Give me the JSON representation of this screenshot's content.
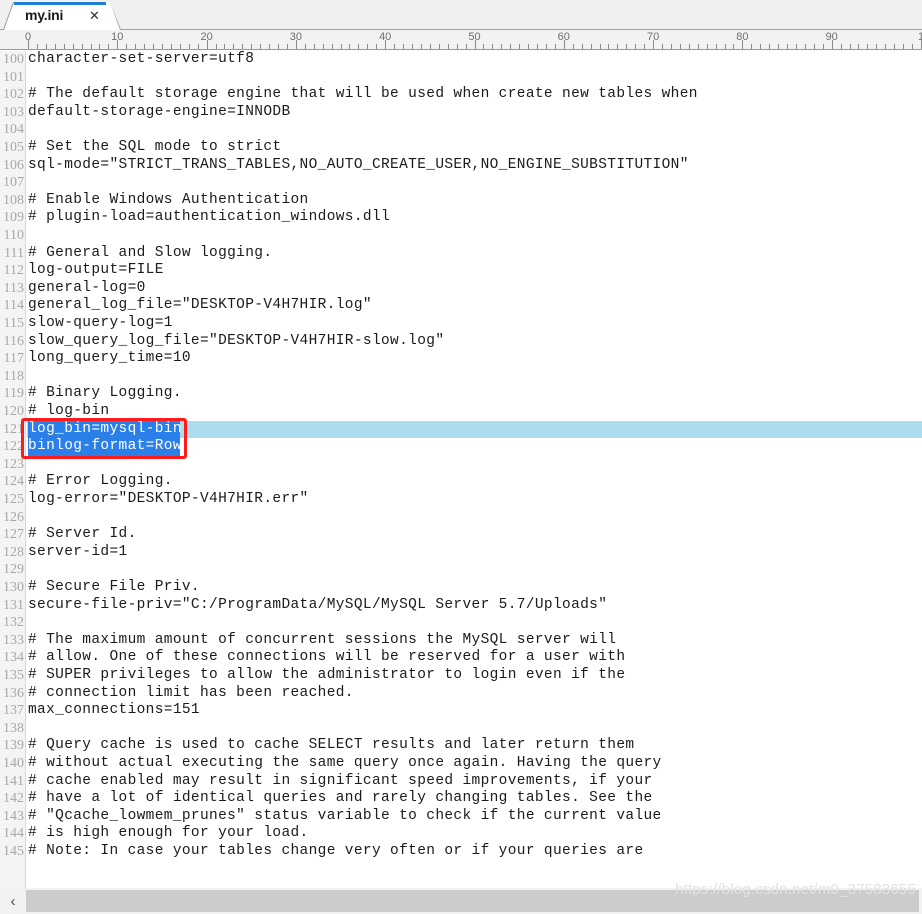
{
  "window": {
    "tab": {
      "title": "my.ini",
      "close_icon": "close-icon",
      "accent_color": "#1f7fd0"
    }
  },
  "ruler": {
    "labels": [
      "0",
      "10",
      "20",
      "30",
      "40",
      "50",
      "60",
      "70",
      "80",
      "90",
      "1"
    ],
    "tick_spacing_chars": 10,
    "unit": "characters"
  },
  "editor": {
    "first_line_number": 100,
    "font": "monospace",
    "current_line_number": 121,
    "current_line_highlight_color": "#addcee",
    "selection_color": "#2a7fe8",
    "selection_text_color": "#ffffff",
    "selected_line_numbers": [
      121,
      122
    ],
    "lines": [
      {
        "n": 100,
        "text": "character-set-server=utf8"
      },
      {
        "n": 101,
        "text": ""
      },
      {
        "n": 102,
        "text": "# The default storage engine that will be used when create new tables when"
      },
      {
        "n": 103,
        "text": "default-storage-engine=INNODB"
      },
      {
        "n": 104,
        "text": ""
      },
      {
        "n": 105,
        "text": "# Set the SQL mode to strict"
      },
      {
        "n": 106,
        "text": "sql-mode=\"STRICT_TRANS_TABLES,NO_AUTO_CREATE_USER,NO_ENGINE_SUBSTITUTION\""
      },
      {
        "n": 107,
        "text": ""
      },
      {
        "n": 108,
        "text": "# Enable Windows Authentication"
      },
      {
        "n": 109,
        "text": "# plugin-load=authentication_windows.dll"
      },
      {
        "n": 110,
        "text": ""
      },
      {
        "n": 111,
        "text": "# General and Slow logging."
      },
      {
        "n": 112,
        "text": "log-output=FILE"
      },
      {
        "n": 113,
        "text": "general-log=0"
      },
      {
        "n": 114,
        "text": "general_log_file=\"DESKTOP-V4H7HIR.log\""
      },
      {
        "n": 115,
        "text": "slow-query-log=1"
      },
      {
        "n": 116,
        "text": "slow_query_log_file=\"DESKTOP-V4H7HIR-slow.log\""
      },
      {
        "n": 117,
        "text": "long_query_time=10"
      },
      {
        "n": 118,
        "text": ""
      },
      {
        "n": 119,
        "text": "# Binary Logging."
      },
      {
        "n": 120,
        "text": "# log-bin"
      },
      {
        "n": 121,
        "text": "log_bin=mysql-bin",
        "selected": true,
        "current": true
      },
      {
        "n": 122,
        "text": "binlog-format=Row",
        "selected": true
      },
      {
        "n": 123,
        "text": ""
      },
      {
        "n": 124,
        "text": "# Error Logging."
      },
      {
        "n": 125,
        "text": "log-error=\"DESKTOP-V4H7HIR.err\""
      },
      {
        "n": 126,
        "text": ""
      },
      {
        "n": 127,
        "text": "# Server Id."
      },
      {
        "n": 128,
        "text": "server-id=1"
      },
      {
        "n": 129,
        "text": ""
      },
      {
        "n": 130,
        "text": "# Secure File Priv."
      },
      {
        "n": 131,
        "text": "secure-file-priv=\"C:/ProgramData/MySQL/MySQL Server 5.7/Uploads\""
      },
      {
        "n": 132,
        "text": ""
      },
      {
        "n": 133,
        "text": "# The maximum amount of concurrent sessions the MySQL server will"
      },
      {
        "n": 134,
        "text": "# allow. One of these connections will be reserved for a user with"
      },
      {
        "n": 135,
        "text": "# SUPER privileges to allow the administrator to login even if the"
      },
      {
        "n": 136,
        "text": "# connection limit has been reached."
      },
      {
        "n": 137,
        "text": "max_connections=151"
      },
      {
        "n": 138,
        "text": ""
      },
      {
        "n": 139,
        "text": "# Query cache is used to cache SELECT results and later return them"
      },
      {
        "n": 140,
        "text": "# without actual executing the same query once again. Having the query"
      },
      {
        "n": 141,
        "text": "# cache enabled may result in significant speed improvements, if your"
      },
      {
        "n": 142,
        "text": "# have a lot of identical queries and rarely changing tables. See the"
      },
      {
        "n": 143,
        "text": "# \"Qcache_lowmem_prunes\" status variable to check if the current value"
      },
      {
        "n": 144,
        "text": "# is high enough for your load."
      },
      {
        "n": 145,
        "text": "# Note: In case your tables change very often or if your queries are"
      }
    ]
  },
  "annotation": {
    "type": "red-rectangle",
    "color": "#ff1b1b",
    "covers_lines": [
      121,
      122
    ]
  },
  "watermark": {
    "text": "https://blog.csdn.net/m0_37583655"
  },
  "scrollbar": {
    "left_arrow_icon": "chevron-left-icon",
    "left_arrow_glyph": "‹"
  }
}
